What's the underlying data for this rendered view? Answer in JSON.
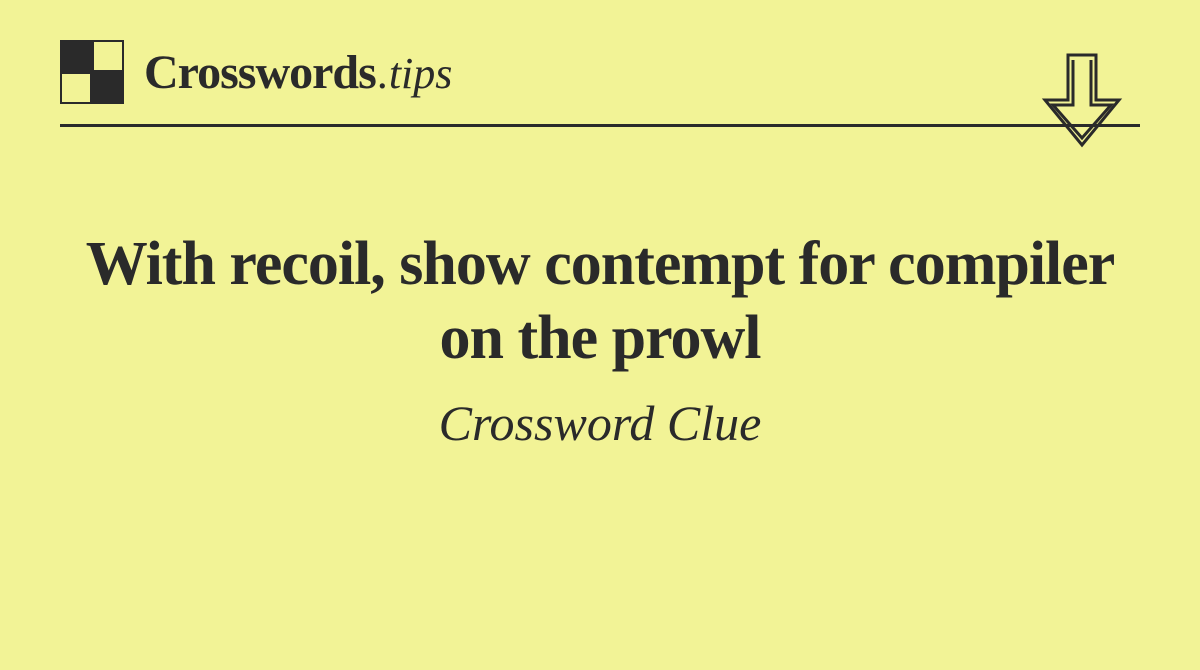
{
  "header": {
    "logo_main": "Crosswords",
    "logo_suffix": ".tips"
  },
  "content": {
    "clue": "With recoil, show contempt for compiler on the prowl",
    "subtitle": "Crossword Clue"
  }
}
